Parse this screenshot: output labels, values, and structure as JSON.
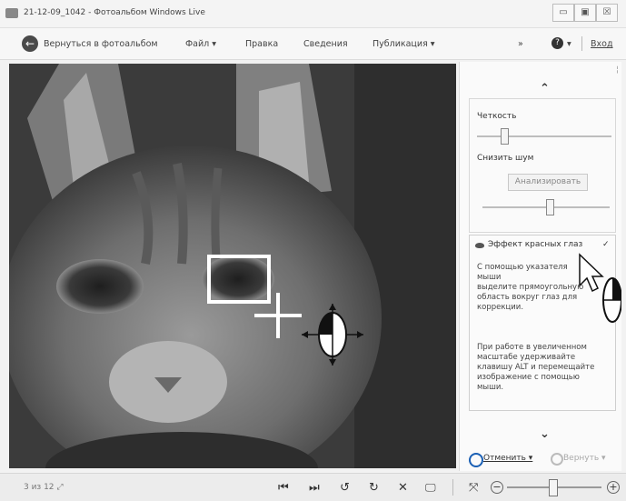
{
  "window": {
    "title": "21-12-09_1042 - Фотоальбом Windows Live",
    "controls": {
      "minimize": "▭",
      "maximize": "▣",
      "close": "☒"
    }
  },
  "menu": {
    "back_label": "Вернуться в фотоальбом",
    "file_label": "Файл ▾",
    "edit_label": "Правка",
    "info_label": "Сведения",
    "publish_label": "Публикация ▾",
    "overflow_label": "»",
    "help_label": "▾",
    "signin_label": "Вход"
  },
  "panel": {
    "collapse_icon": "⌃",
    "sharpness_label": "Четкость",
    "denoise_label": "Снизить шум",
    "analyze_button": "Анализировать",
    "redeye": {
      "title": "Эффект красных глаз",
      "para1": [
        "С помощью указателя мыши",
        "выделите прямоугольную",
        "область вокруг глаз для",
        "коррекции."
      ],
      "para2": [
        "При работе в увеличенном",
        "масштабе удерживайте",
        "клавишу ALT и перемещайте",
        "изображение с помощью",
        "мыши."
      ]
    },
    "expand_icon": "⌄",
    "undo_label": "Отменить ▾",
    "redo_label": "Вернуть ▾"
  },
  "status": {
    "file_info": "3 из 12 ⤢",
    "prev_icon": "⏮",
    "next_icon": "⏭",
    "rotate_left_icon": "↺",
    "rotate_right_icon": "↻",
    "delete_icon": "✕",
    "slideshow_icon": "🖵",
    "fit_icon": "⤧",
    "zoom_out_icon": "−",
    "zoom_in_icon": "+"
  },
  "colors": {
    "accent": "#1a5fb4",
    "photo_bg": "#4a4a4a",
    "selection": "#ffffff"
  }
}
